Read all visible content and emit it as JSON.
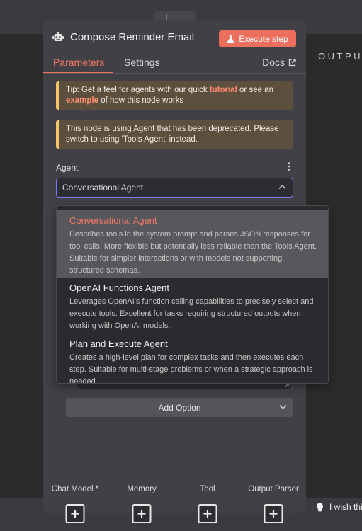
{
  "node": {
    "title": "Compose Reminder Email",
    "execute_label": "Execute step"
  },
  "tabs": [
    {
      "label": "Parameters",
      "active": true
    },
    {
      "label": "Settings",
      "active": false
    }
  ],
  "docs_label": "Docs",
  "output_label": "OUTPUT",
  "tip": {
    "prefix": "Tip: Get a feel for agents with our quick ",
    "link1": "tutorial",
    "middle": " or see an ",
    "link2": "example",
    "suffix": " of how this node works"
  },
  "deprecation_notice": "This node is using Agent that has been deprecated. Please switch to using 'Tools Agent' instead.",
  "agent": {
    "label": "Agent",
    "value": "Conversational Agent",
    "options": [
      {
        "title": "Conversational Agent",
        "description": "Describes tools in the system prompt and parses JSON responses for tool calls. More flexible but potentially less reliable than the Tools Agent. Suitable for simpler interactions or with models not supporting structured schemas.",
        "selected": true
      },
      {
        "title": "OpenAI Functions Agent",
        "description": "Leverages OpenAI's function calling capabilities to precisely select and execute tools. Excellent for tasks requiring structured outputs when working with OpenAI models.",
        "selected": false
      },
      {
        "title": "Plan and Execute Agent",
        "description": "Creates a high-level plan for complex tasks and then executes each step. Suitable for multi-stage problems or when a strategic approach is needed.",
        "selected": false
      }
    ]
  },
  "add_option_label": "Add Option",
  "connectors": [
    {
      "label": "Chat Model *"
    },
    {
      "label": "Memory"
    },
    {
      "label": "Tool"
    },
    {
      "label": "Output Parser"
    }
  ],
  "wish_text": "I wish this",
  "colors": {
    "accent": "#ec6e5d",
    "panel": "#414145",
    "notice_bg": "#5c4f3e",
    "notice_border": "#f3c46b",
    "focus_border": "#7a7cf0"
  }
}
